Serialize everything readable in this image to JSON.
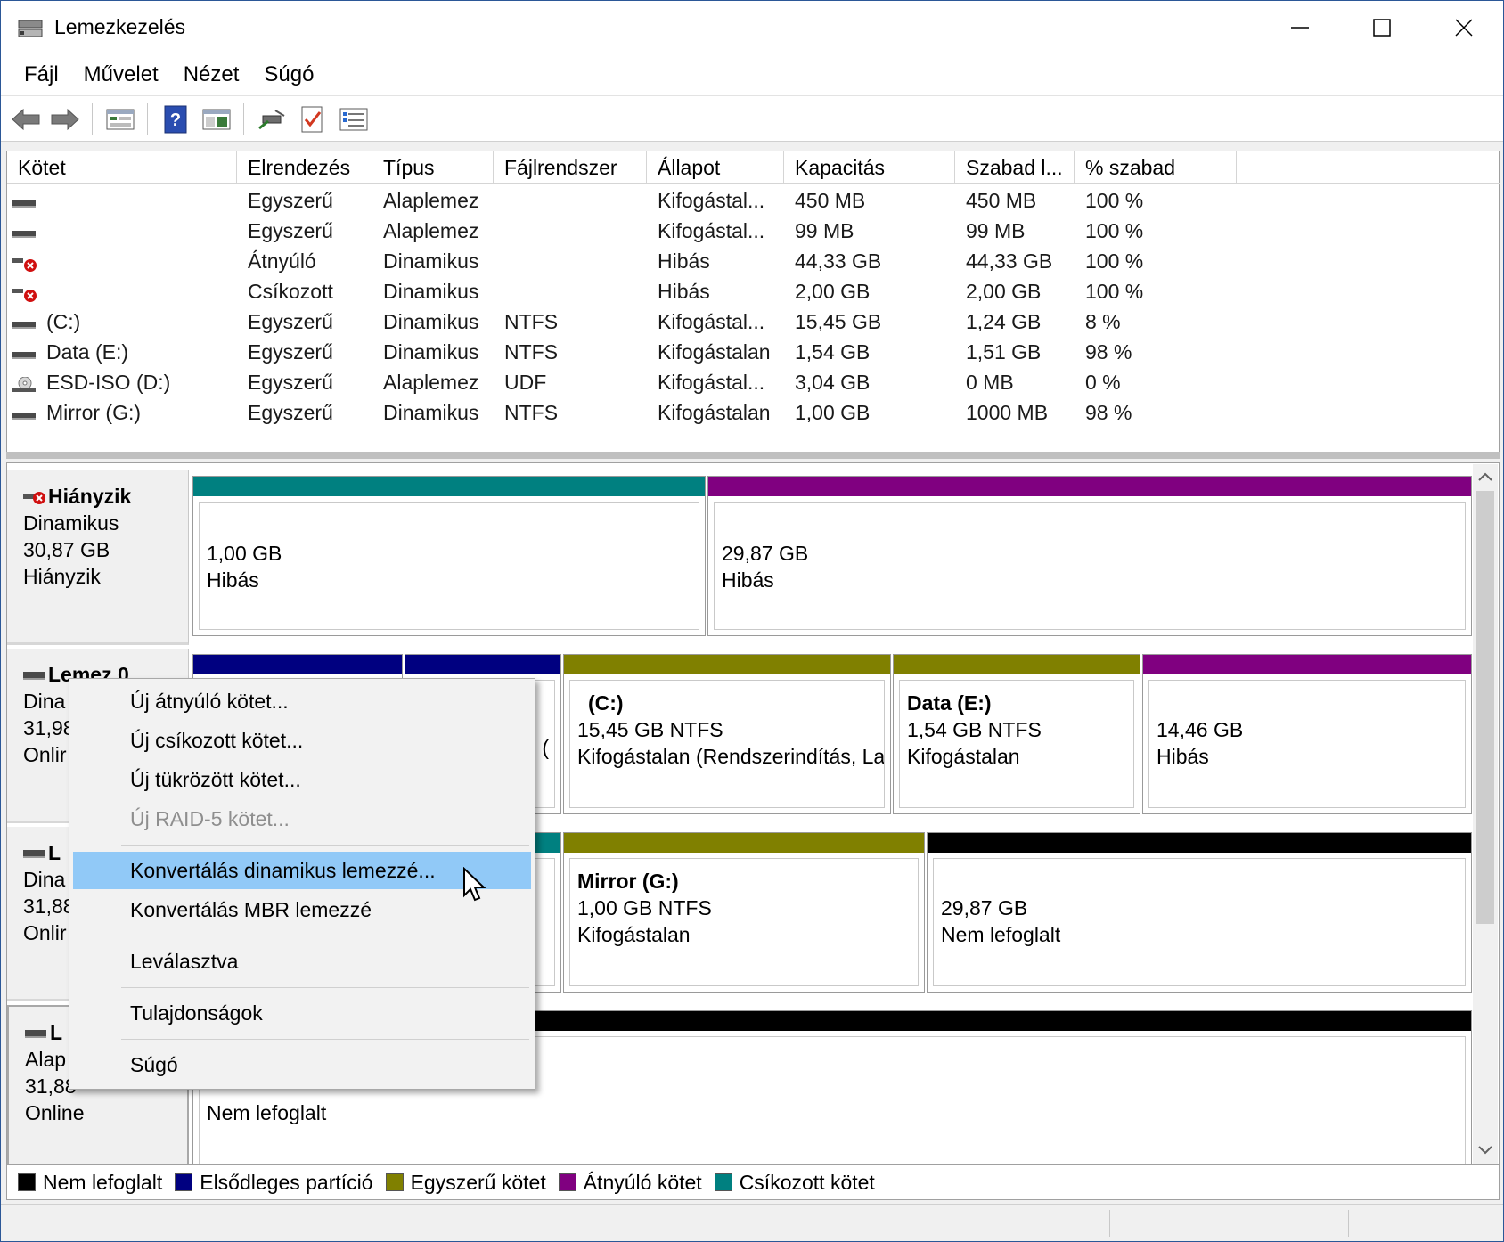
{
  "window": {
    "title": "Lemezkezelés"
  },
  "menu": [
    "Fájl",
    "Művelet",
    "Nézet",
    "Súgó"
  ],
  "toolbar": [
    "back-icon",
    "forward-icon",
    "disk-view-icon",
    "help-icon",
    "properties-icon",
    "connect-icon",
    "check-icon",
    "list-icon"
  ],
  "columns": [
    "Kötet",
    "Elrendezés",
    "Típus",
    "Fájlrendszer",
    "Állapot",
    "Kapacitás",
    "Szabad l...",
    "% szabad"
  ],
  "volumes": [
    {
      "icon": "disk",
      "name": "",
      "layout": "Egyszerű",
      "type": "Alaplemez",
      "fs": "",
      "status": "Kifogástal...",
      "capacity": "450 MB",
      "free": "450 MB",
      "pct": "100 %"
    },
    {
      "icon": "disk",
      "name": "",
      "layout": "Egyszerű",
      "type": "Alaplemez",
      "fs": "",
      "status": "Kifogástal...",
      "capacity": "99 MB",
      "free": "99 MB",
      "pct": "100 %"
    },
    {
      "icon": "error",
      "name": "",
      "layout": "Átnyúló",
      "type": "Dinamikus",
      "fs": "",
      "status": "Hibás",
      "capacity": "44,33 GB",
      "free": "44,33 GB",
      "pct": "100 %"
    },
    {
      "icon": "error",
      "name": "",
      "layout": "Csíkozott",
      "type": "Dinamikus",
      "fs": "",
      "status": "Hibás",
      "capacity": "2,00 GB",
      "free": "2,00 GB",
      "pct": "100 %"
    },
    {
      "icon": "disk",
      "name": " (C:)",
      "layout": "Egyszerű",
      "type": "Dinamikus",
      "fs": "NTFS",
      "status": "Kifogástal...",
      "capacity": "15,45 GB",
      "free": "1,24 GB",
      "pct": "8 %"
    },
    {
      "icon": "disk",
      "name": "Data (E:)",
      "layout": "Egyszerű",
      "type": "Dinamikus",
      "fs": "NTFS",
      "status": "Kifogástalan",
      "capacity": "1,54 GB",
      "free": "1,51 GB",
      "pct": "98 %"
    },
    {
      "icon": "cd",
      "name": "ESD-ISO (D:)",
      "layout": "Egyszerű",
      "type": "Alaplemez",
      "fs": "UDF",
      "status": "Kifogástal...",
      "capacity": "3,04 GB",
      "free": "0 MB",
      "pct": "0 %"
    },
    {
      "icon": "disk",
      "name": "Mirror (G:)",
      "layout": "Egyszerű",
      "type": "Dinamikus",
      "fs": "NTFS",
      "status": "Kifogástalan",
      "capacity": "1,00 GB",
      "free": "1000 MB",
      "pct": "98 %"
    }
  ],
  "disks": {
    "missing": {
      "name": "Hiányzik",
      "type": "Dinamikus",
      "size": "30,87 GB",
      "status": "Hiányzik",
      "parts": [
        {
          "l1": "1,00 GB",
          "l2": "Hibás"
        },
        {
          "l1": "29,87 GB",
          "l2": "Hibás"
        }
      ]
    },
    "disk0": {
      "name": "Lemez 0",
      "type": "Dina",
      "size": "31,98",
      "status": "Onlir",
      "parts": [
        {
          "l2": "("
        },
        {
          "title": "(C:)",
          "l1": "15,45 GB NTFS",
          "l2": "Kifogástalan (Rendszerindítás, La"
        },
        {
          "title": "Data  (E:)",
          "l1": "1,54 GB NTFS",
          "l2": "Kifogástalan"
        },
        {
          "l1": "14,46 GB",
          "l2": "Hibás"
        }
      ]
    },
    "disk1": {
      "name": "L",
      "type": "Dina",
      "size": "31,88",
      "status": "Onlir",
      "parts": [
        {
          "title": "Mirror  (G:)",
          "l1": "1,00 GB NTFS",
          "l2": "Kifogástalan"
        },
        {
          "l1": "29,87 GB",
          "l2": "Nem lefoglalt"
        }
      ]
    },
    "disk2": {
      "name": "L",
      "type": "Alap",
      "size": "31,88",
      "status": "Online",
      "parts": [
        {
          "l2": "Nem lefoglalt"
        }
      ]
    }
  },
  "legend": [
    {
      "label": "Nem lefoglalt",
      "color": "#000000"
    },
    {
      "label": "Elsődleges partíció",
      "color": "#000080"
    },
    {
      "label": "Egyszerű kötet",
      "color": "#808000"
    },
    {
      "label": "Átnyúló kötet",
      "color": "#800080"
    },
    {
      "label": "Csíkozott kötet",
      "color": "#008080"
    }
  ],
  "colors": {
    "unallocated": "#000000",
    "primary": "#000080",
    "simple": "#808000",
    "spanned": "#800080",
    "striped": "#008080",
    "menu_highlight": "#91c9f7"
  },
  "context_menu": {
    "items": [
      {
        "label": "Új átnyúló kötet...",
        "enabled": true
      },
      {
        "label": "Új csíkozott kötet...",
        "enabled": true
      },
      {
        "label": "Új tükrözött kötet...",
        "enabled": true
      },
      {
        "label": "Új RAID-5 kötet...",
        "enabled": false
      },
      {
        "label": "Konvertálás dinamikus lemezzé...",
        "enabled": true,
        "highlighted": true
      },
      {
        "label": "Konvertálás MBR lemezzé",
        "enabled": true
      },
      {
        "label": "Leválasztva",
        "enabled": true
      },
      {
        "label": "Tulajdonságok",
        "enabled": true
      },
      {
        "label": "Súgó",
        "enabled": true
      }
    ]
  }
}
